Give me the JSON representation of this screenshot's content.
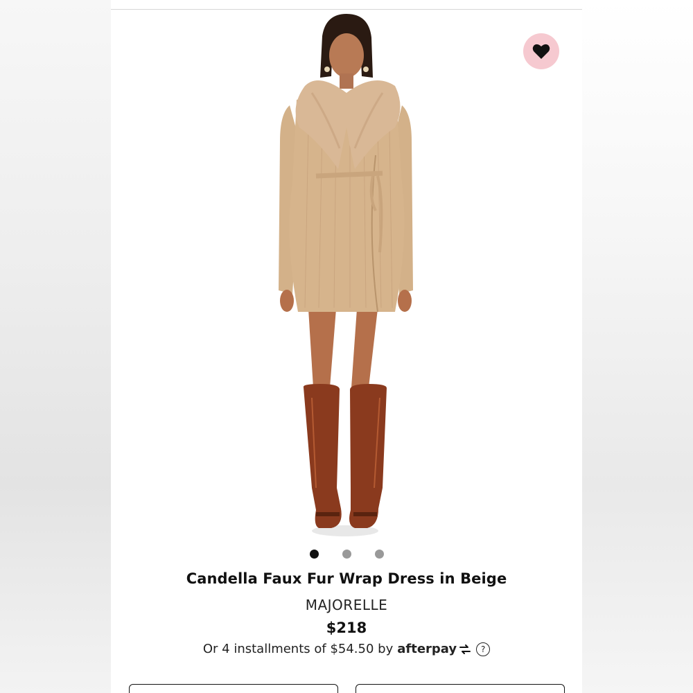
{
  "product": {
    "title": "Candella Faux Fur Wrap Dress in Beige",
    "brand": "MAJORELLE",
    "price": "$218",
    "installments_text": "Or 4 installments of $54.50 by",
    "payment_provider": "afterpay",
    "help_symbol": "?"
  },
  "image": {
    "alt": "Model wearing beige faux fur wrap dress with brown knee-high boots",
    "carousel_count": 3,
    "carousel_active_index": 0
  },
  "favorite": {
    "icon": "heart-icon",
    "background_color": "#f6c9d0"
  },
  "colors": {
    "dress": "#d6b48c",
    "fur": "#d9b896",
    "boots": "#8a3a1e",
    "text": "#111111"
  }
}
